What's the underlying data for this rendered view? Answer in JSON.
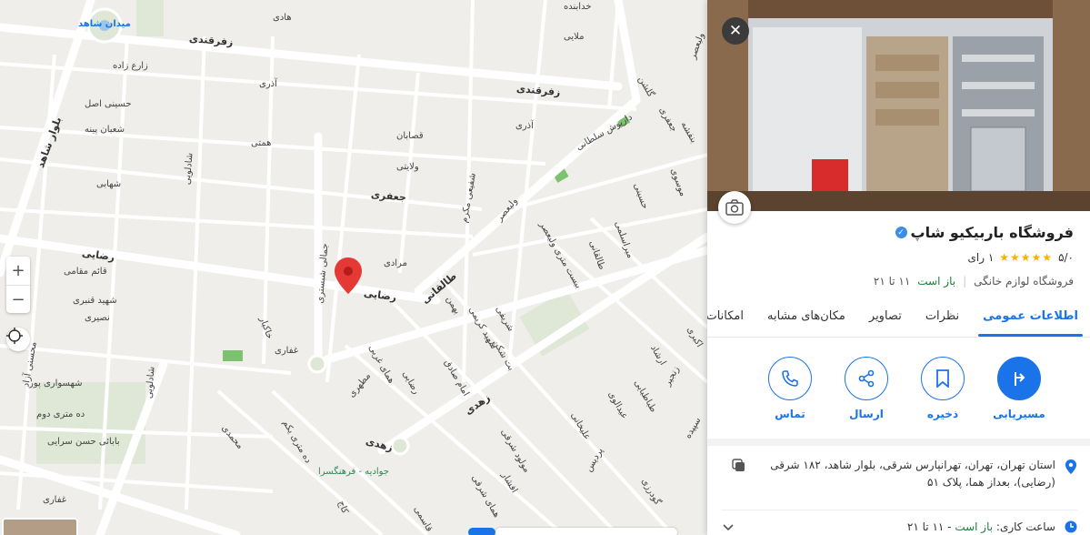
{
  "map": {
    "streets": {
      "zafarghandi_1": "زفرقندی",
      "zafarghandi_2": "زفرقندی",
      "hadi": "هادی",
      "khodabandeh": "خدابنده",
      "malayi": "ملایی",
      "vali_asr": "ولیعصر",
      "golshan": "گلشن",
      "meydan_shahed": "میدان شاهد",
      "zareh_zadeh": "زارع زاده",
      "azari_1": "آذری",
      "azari_2": "آذری",
      "hosseini_asl": "حسینی اصل",
      "shaban_pineh": "شعبان پینه",
      "boulevard_shahed": "بلوار شاهد",
      "hemmati": "همتی",
      "ghassaban": "قصابان",
      "velayati": "ولایتی",
      "darioush_soltani": "داریوش سلطانی",
      "banafsheh": "بنفشه",
      "jafari_1": "جعفری",
      "jafari_2": "جعفری",
      "shahabi": "شهابی",
      "shadlooyi_1": "شادلویی",
      "shadlooyi_2": "شادلویی",
      "jafari_small": "جعفری",
      "mousavi": "موسوی",
      "hosseini": "حسینی",
      "shafiei_mokarram": "شفیعی مکرم",
      "valiasr_2": "ولیعصر",
      "mir_eskandari": "میراسلمی",
      "bist_metri": "بیست متری ولیعصر",
      "taleghani_1": "طالقانی",
      "rezayi_1": "رضایی",
      "ghaem_maghami": "قائم مقامی",
      "shahid_ghanbari": "شهید قنبری",
      "nasiri": "نصیری",
      "jamali_shabestari": "جمالی شبستری",
      "moradi": "مرادی",
      "rezayi_2": "رضایی",
      "taleghani_2": "طالقانی",
      "bahaman": "بهمن",
      "shahid_karimi": "شهید کریمی",
      "sharifi": "شریفی",
      "ershad": "ارشاد",
      "akbari": "اکبری",
      "zanjir": "زنجیر",
      "khakbar": "خاکبار",
      "ghaffari_1": "غفاری",
      "tobekhane": "بت شکن",
      "rezayi_3": "رضایی",
      "homayi_gharbi": "همای غربی",
      "motahari": "مطهری",
      "imam_sadegh": "امام صادق",
      "zahedi_1": "زهدی",
      "tabatabayi": "طباطبایی",
      "eydoloyi": "عیدالوی",
      "alikhani": "علیخانی",
      "sepideh": "سپیده",
      "shahrsavari": "شهسواری پور",
      "dah_metri_doom": "ده متری دوم",
      "babayi_hassan": "بابائی حسن سرایی",
      "mohseni_azad": "محسنی آزاد",
      "mohammadi": "محمدی",
      "dah_metri_yekom": "ده متری یکم",
      "zahedi_2": "زهدی",
      "javadieh_farhangsara": "جوادیه - فرهنگسرا",
      "mowlood_sharghi": "مولود شرقی",
      "afshar": "افشار",
      "pardis": "پردیس",
      "godarzi": "گودرزی",
      "homayi_sharghi": "همای شرقی",
      "kaj": "کاج",
      "ghaffari_2": "غفاری",
      "ghasemi": "قاسمی"
    },
    "zoom_in": "+",
    "zoom_out": "−"
  },
  "place": {
    "name": "فروشگاه باربیکیو شاپ",
    "verified": "✓",
    "rating": "۵/۰",
    "stars": "★★★★★",
    "reviews": "۱ رای",
    "category": "فروشگاه لوازم خانگی",
    "status": "باز است",
    "hours_short": "۱۱ تا ۲۱"
  },
  "tabs": [
    "اطلاعات عمومی",
    "نظرات",
    "تصاویر",
    "مکان‌های مشابه",
    "امکانات ن"
  ],
  "actions": {
    "directions": "مسیریابی",
    "save": "ذخیره",
    "share": "ارسال",
    "call": "تماس"
  },
  "details": {
    "address": "استان تهران، تهران، تهرانپارس شرقی، بلوار شاهد، ۱۸۲ شرقی (رضایی)، بعداز هما، پلاک ۵۱",
    "hours_label": "ساعت کاری:",
    "hours_status": "باز است",
    "hours_value": "- ۱۱ تا ۲۱"
  },
  "colors": {
    "accent": "#1a73e8",
    "open": "#1a7f37",
    "pin": "#e53935",
    "star": "#f5b301"
  }
}
